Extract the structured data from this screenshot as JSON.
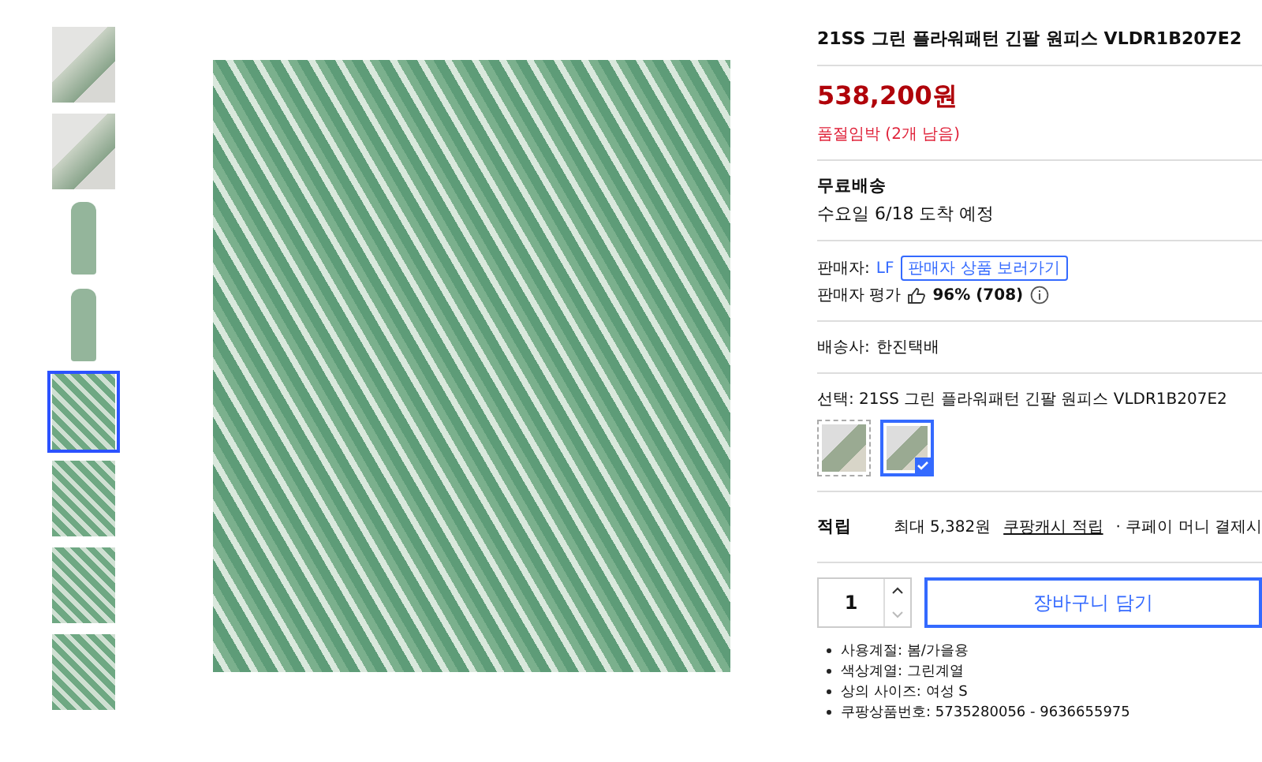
{
  "thumbnails": [
    {
      "kind": "model",
      "selected": false
    },
    {
      "kind": "model",
      "selected": false
    },
    {
      "kind": "dress",
      "selected": false
    },
    {
      "kind": "dress",
      "selected": false
    },
    {
      "kind": "detail",
      "selected": true
    },
    {
      "kind": "detail",
      "selected": false
    },
    {
      "kind": "detail",
      "selected": false
    },
    {
      "kind": "detail",
      "selected": false
    }
  ],
  "product": {
    "title": "21SS 그린 플라워패턴 긴팔 원피스 VLDR1B207E2",
    "price": "538,200원",
    "stock_note": "품절임박 (2개 남음)"
  },
  "shipping": {
    "label": "무료배송",
    "arrival": "수요일 6/18 도착 예정"
  },
  "seller": {
    "label": "판매자:",
    "name": "LF",
    "link": "판매자 상품 보러가기",
    "rating_label": "판매자 평가",
    "rating": "96% (708)"
  },
  "carrier": {
    "label": "배송사:",
    "name": "한진택배"
  },
  "option": {
    "label": "선택: 21SS 그린 플라워패턴 긴팔 원피스 VLDR1B207E2",
    "swatches": [
      {
        "selected": false
      },
      {
        "selected": true
      }
    ]
  },
  "reward": {
    "label": "적립",
    "amount": "최대 5,382원",
    "link": "쿠팡캐시 적립",
    "note": "· 쿠페이 머니 결제시"
  },
  "quantity": "1",
  "cart_button": "장바구니 담기",
  "specs": [
    "사용계절: 봄/가을용",
    "색상계열: 그린계열",
    "상의 사이즈: 여성 S",
    "쿠팡상품번호: 5735280056 - 9636655975"
  ]
}
